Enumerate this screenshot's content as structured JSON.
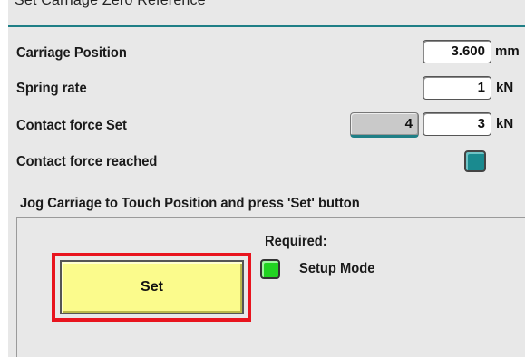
{
  "window": {
    "title": "Set Carriage Zero Reference"
  },
  "rows": {
    "carriage_position": {
      "label": "Carriage Position",
      "value": "3.600",
      "unit": "mm"
    },
    "spring_rate": {
      "label": "Spring rate",
      "value": "1",
      "unit": "kN"
    },
    "contact_force_set": {
      "label": "Contact force Set",
      "actual_value": "4",
      "value": "3",
      "unit": "kN"
    },
    "contact_force_reached": {
      "label": "Contact force reached",
      "indicator_color": "#1a8a8f"
    }
  },
  "instruction": "Jog Carriage to Touch Position and press 'Set' button",
  "requirements": {
    "heading": "Required:",
    "items": [
      {
        "label": "Setup Mode",
        "status_color": "#21d321"
      }
    ]
  },
  "set_button": {
    "label": "Set",
    "color": "#fbfb8c",
    "highlight_color": "#e8141e"
  },
  "colors": {
    "accent": "#1f7f86",
    "background": "#e8e8e8"
  }
}
